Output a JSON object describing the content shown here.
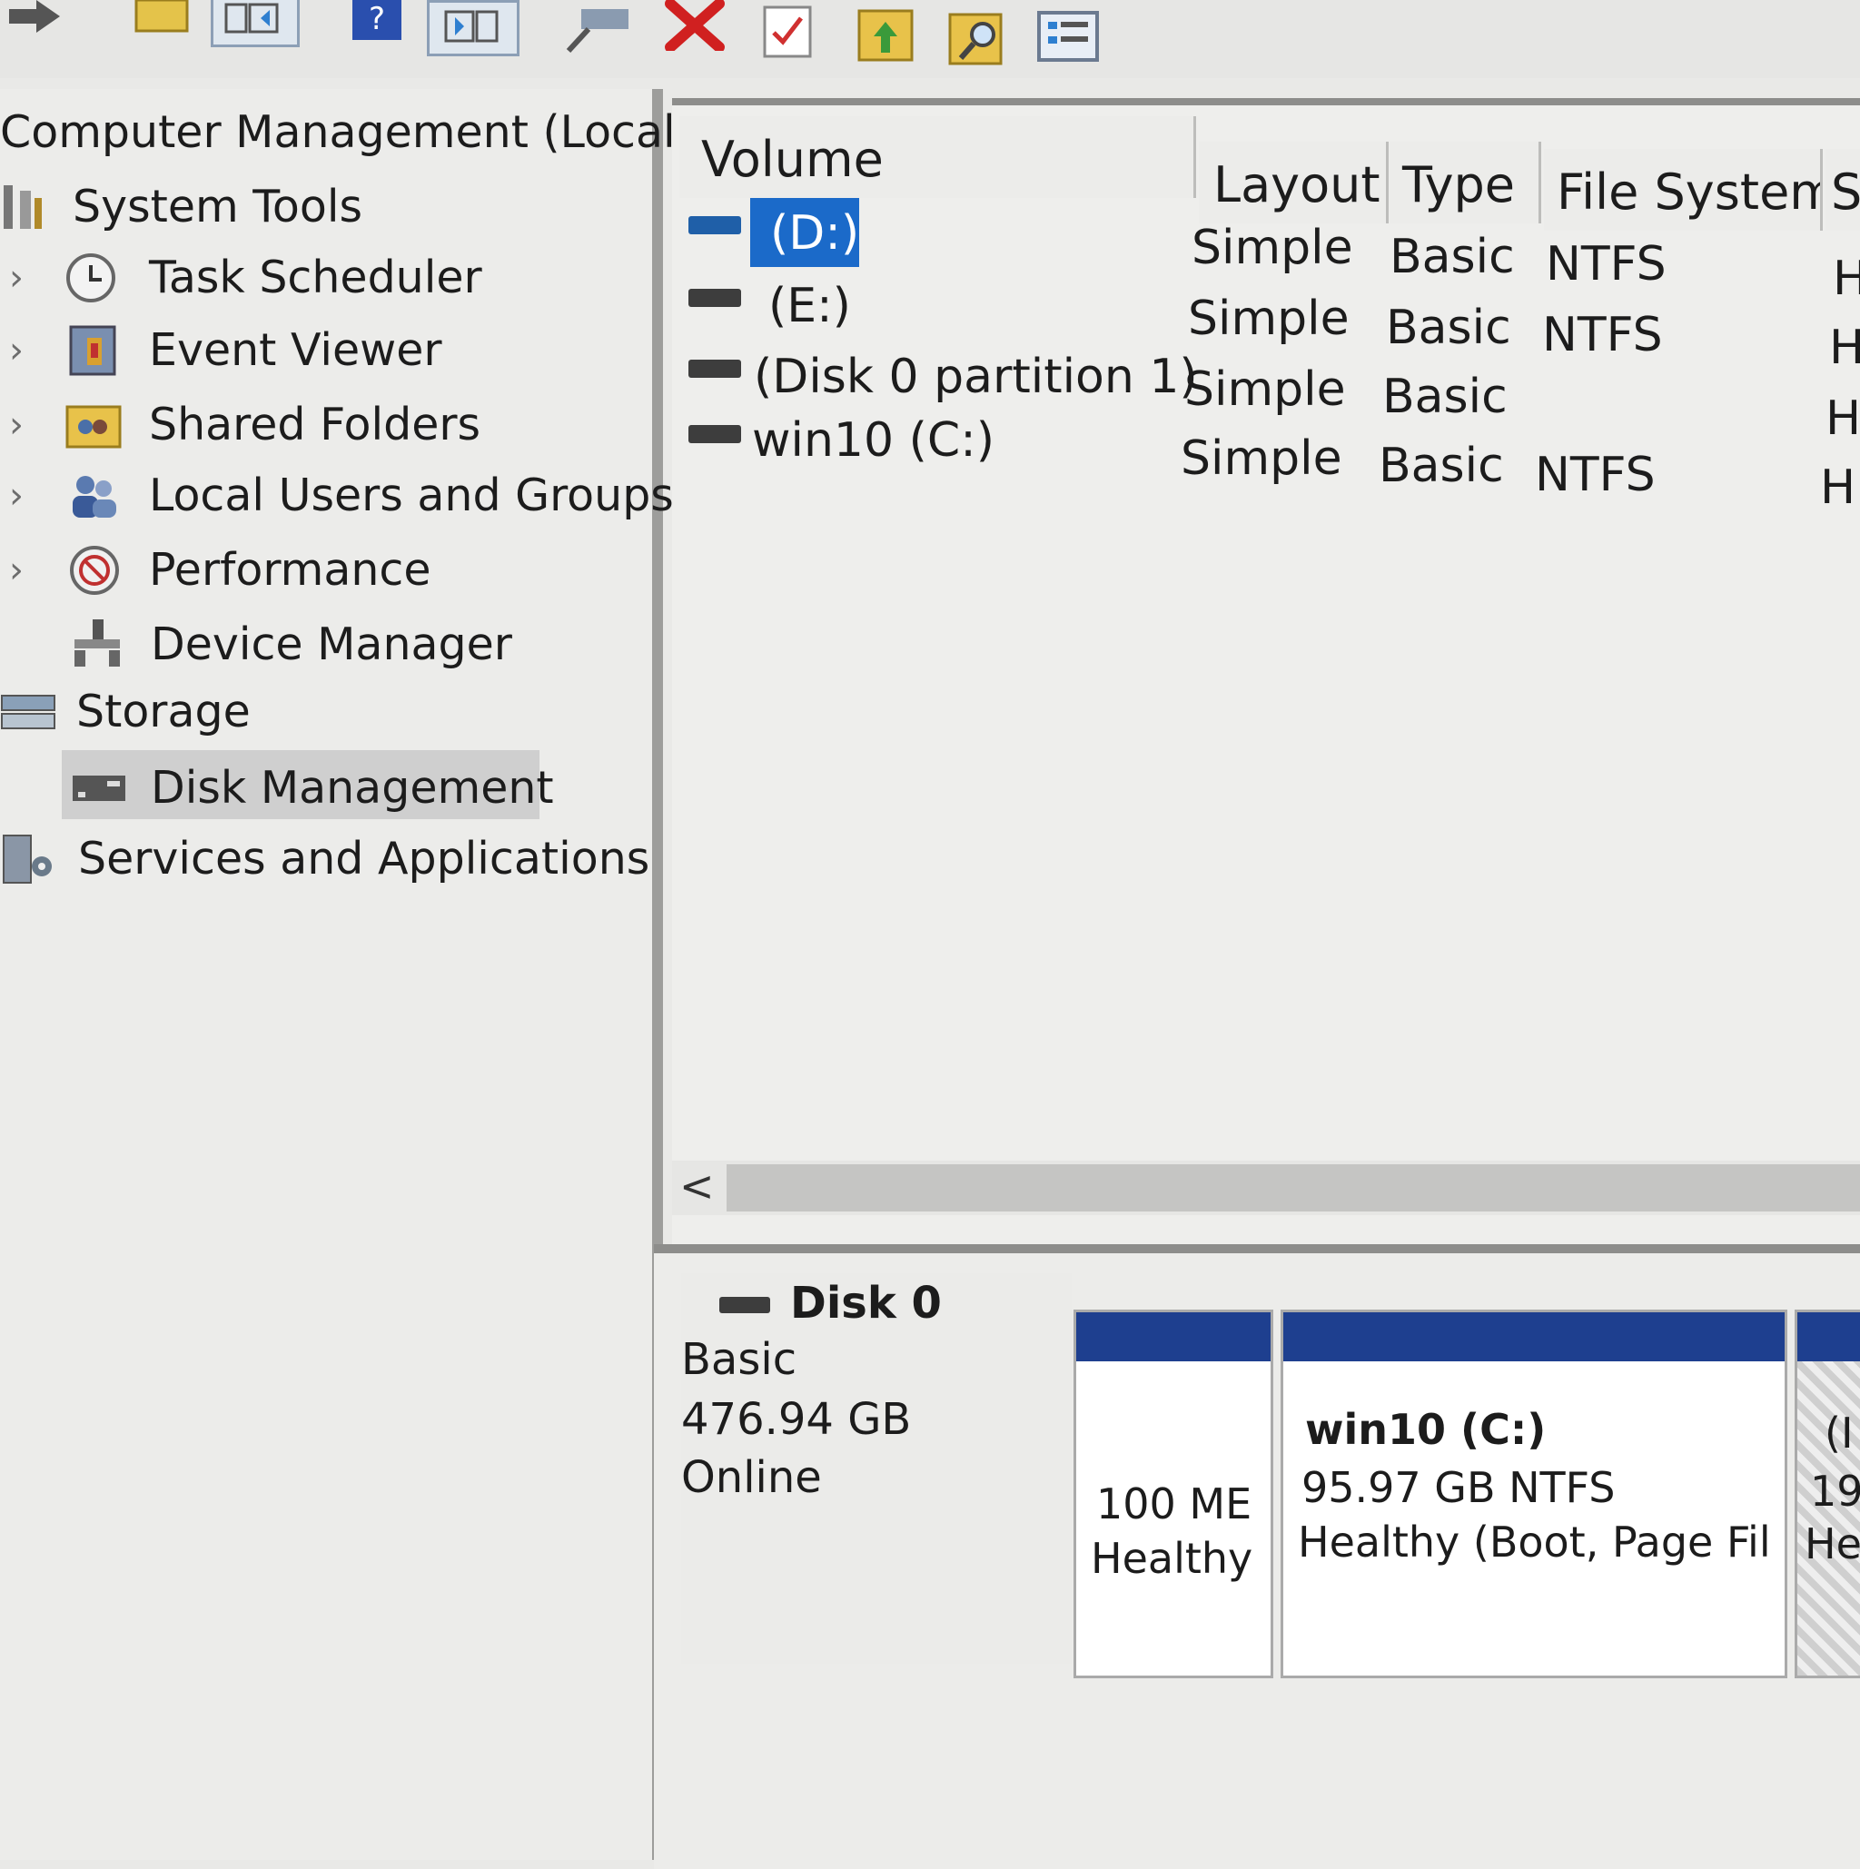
{
  "toolbar": {
    "icons": [
      "back-arrow-icon",
      "folder-up-icon",
      "show-hide-tree-icon",
      "help-icon",
      "show-action-pane-icon",
      "connect-icon",
      "delete-icon",
      "properties-icon",
      "folder-up-arrow-icon",
      "search-icon",
      "list-icon"
    ]
  },
  "tree": {
    "root": "Computer Management (Local)",
    "items": [
      {
        "label": "System Tools",
        "icon": "tools-icon"
      },
      {
        "label": "Task Scheduler",
        "icon": "clock-icon"
      },
      {
        "label": "Event Viewer",
        "icon": "event-viewer-icon"
      },
      {
        "label": "Shared Folders",
        "icon": "shared-folder-icon"
      },
      {
        "label": "Local Users and Groups",
        "icon": "users-icon"
      },
      {
        "label": "Performance",
        "icon": "performance-icon"
      },
      {
        "label": "Device Manager",
        "icon": "device-manager-icon"
      },
      {
        "label": "Storage",
        "icon": "storage-icon"
      },
      {
        "label": "Disk Management",
        "icon": "disk-management-icon"
      },
      {
        "label": "Services and Applications",
        "icon": "services-icon"
      }
    ]
  },
  "volumes": {
    "columns": [
      "Volume",
      "Layout",
      "Type",
      "File System",
      "S"
    ],
    "rows": [
      {
        "volume": "(D:)",
        "layout": "Simple",
        "type": "Basic",
        "fs": "NTFS",
        "status": "H"
      },
      {
        "volume": "(E:)",
        "layout": "Simple",
        "type": "Basic",
        "fs": "NTFS",
        "status": "H"
      },
      {
        "volume": "(Disk 0 partition 1)",
        "layout": "Simple",
        "type": "Basic",
        "fs": "",
        "status": "H"
      },
      {
        "volume": "win10 (C:)",
        "layout": "Simple",
        "type": "Basic",
        "fs": "NTFS",
        "status": "H"
      }
    ],
    "scroll_left": "<"
  },
  "disk": {
    "title": "Disk 0",
    "type": "Basic",
    "size": "476.94 GB",
    "status": "Online",
    "partitions": [
      {
        "line1": "",
        "line2": "100 ME",
        "line3": "Healthy"
      },
      {
        "line1": "win10  (C:)",
        "line2": "95.97 GB NTFS",
        "line3": "Healthy (Boot, Page Fil"
      },
      {
        "line1": "(I",
        "line2": "19",
        "line3": "He"
      }
    ]
  },
  "colors": {
    "accent": "#1b6ac9",
    "partition_bar": "#1e3f8f"
  }
}
